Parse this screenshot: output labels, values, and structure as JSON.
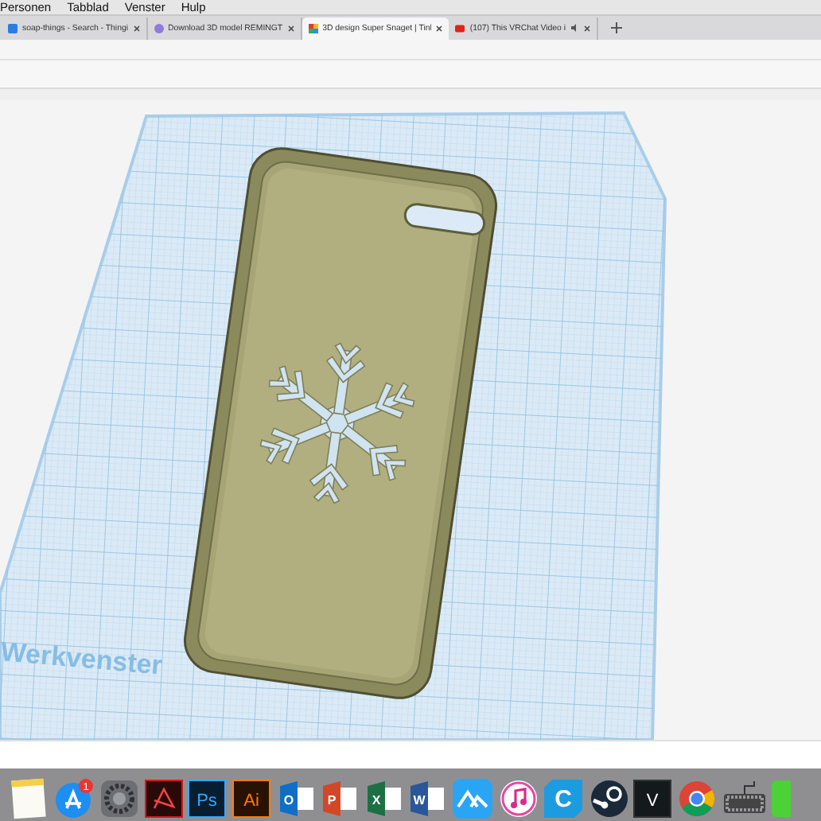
{
  "menu": [
    {
      "label": "Personen"
    },
    {
      "label": "Tabblad"
    },
    {
      "label": "Venster"
    },
    {
      "label": "Hulp"
    }
  ],
  "tabs": [
    {
      "title": "soap-things - Search - Thingi",
      "kind": "thingiverse",
      "selected": false,
      "audio": false
    },
    {
      "title": "Download 3D model REMINGT",
      "kind": "model",
      "selected": false,
      "audio": false
    },
    {
      "title": "3D design Super Snaget | Tinl",
      "kind": "tinkercad",
      "selected": true,
      "audio": false
    },
    {
      "title": "(107) This VRChat Video i",
      "kind": "youtube",
      "selected": false,
      "audio": true
    }
  ],
  "workplane": {
    "label": "Werkvenster"
  },
  "dock": [
    {
      "kind": "notes"
    },
    {
      "kind": "appstore",
      "badge": "1"
    },
    {
      "kind": "settings"
    },
    {
      "kind": "acrobat"
    },
    {
      "kind": "ps",
      "label": "Ps"
    },
    {
      "kind": "ai",
      "label": "Ai"
    },
    {
      "kind": "outlook",
      "label": "O"
    },
    {
      "kind": "powerpoint",
      "label": "P"
    },
    {
      "kind": "excel",
      "label": "X"
    },
    {
      "kind": "word",
      "label": "W"
    },
    {
      "kind": "mountain"
    },
    {
      "kind": "music"
    },
    {
      "kind": "c-app",
      "label": "C"
    },
    {
      "kind": "steam"
    },
    {
      "kind": "v-app",
      "label": "V"
    },
    {
      "kind": "chrome"
    },
    {
      "kind": "keyboard"
    },
    {
      "kind": "green"
    }
  ]
}
